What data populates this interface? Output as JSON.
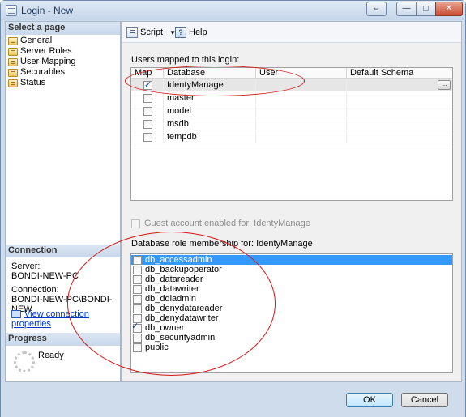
{
  "window": {
    "title": "Login - New",
    "controls": {
      "restore": "⇔",
      "minimize": "—",
      "maximize": "□",
      "close": "✕"
    }
  },
  "left": {
    "select_page_header": "Select a page",
    "pages": [
      "General",
      "Server Roles",
      "User Mapping",
      "Securables",
      "Status"
    ],
    "connection_header": "Connection",
    "server_label": "Server:",
    "server_value": "BONDI-NEW-PC",
    "connection_label": "Connection:",
    "connection_value": "BONDI-NEW-PC\\BONDI-NEW",
    "view_connection_link": "View connection properties",
    "progress_header": "Progress",
    "progress_status": "Ready"
  },
  "toolbar": {
    "script_label": "Script",
    "help_label": "Help",
    "icons": {
      "script": "script-icon",
      "help": "help-icon"
    }
  },
  "users_mapped": {
    "label": "Users mapped to this login:",
    "columns": [
      "Map",
      "Database",
      "User",
      "Default Schema"
    ],
    "rows": [
      {
        "map": true,
        "database": "IdentyManage",
        "user": "",
        "schema": ""
      },
      {
        "map": false,
        "database": "master",
        "user": "",
        "schema": ""
      },
      {
        "map": false,
        "database": "model",
        "user": "",
        "schema": ""
      },
      {
        "map": false,
        "database": "msdb",
        "user": "",
        "schema": ""
      },
      {
        "map": false,
        "database": "tempdb",
        "user": "",
        "schema": ""
      }
    ],
    "ellipsis_label": "..."
  },
  "guest": {
    "label": "Guest account enabled for: IdentyManage",
    "checked": false,
    "enabled": false
  },
  "roles": {
    "label": "Database role membership for: IdentyManage",
    "items": [
      {
        "name": "db_accessadmin",
        "checked": false,
        "selected": true
      },
      {
        "name": "db_backupoperator",
        "checked": false,
        "selected": false
      },
      {
        "name": "db_datareader",
        "checked": false,
        "selected": false
      },
      {
        "name": "db_datawriter",
        "checked": false,
        "selected": false
      },
      {
        "name": "db_ddladmin",
        "checked": false,
        "selected": false
      },
      {
        "name": "db_denydatareader",
        "checked": false,
        "selected": false
      },
      {
        "name": "db_denydatawriter",
        "checked": false,
        "selected": false
      },
      {
        "name": "db_owner",
        "checked": true,
        "selected": false
      },
      {
        "name": "db_securityadmin",
        "checked": false,
        "selected": false
      },
      {
        "name": "public",
        "checked": false,
        "selected": false
      }
    ]
  },
  "buttons": {
    "ok": "OK",
    "cancel": "Cancel"
  },
  "colors": {
    "annotation": "#d51818",
    "selection": "#3399ff",
    "link": "#0033cc"
  }
}
